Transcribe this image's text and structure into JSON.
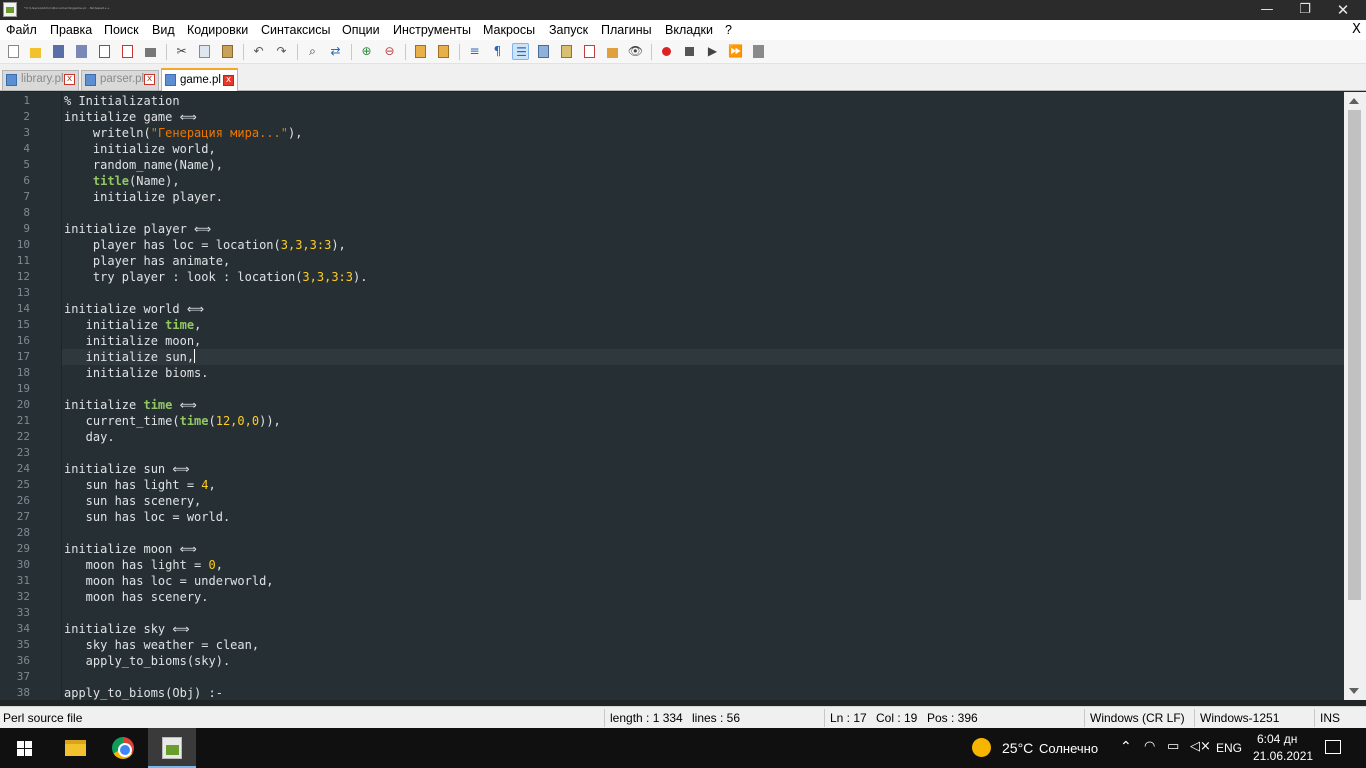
{
  "window": {
    "title": "*C:\\Users\\Admin\\Documents\\game.pl - Notepad++",
    "minimize": "—",
    "maximize": "❐",
    "close": "✕"
  },
  "menu": {
    "items": [
      "Файл",
      "Правка",
      "Поиск",
      "Вид",
      "Кодировки",
      "Синтаксисы",
      "Опции",
      "Инструменты",
      "Макросы",
      "Запуск",
      "Плагины",
      "Вкладки",
      "?"
    ],
    "close_doc": "X"
  },
  "tabs": [
    {
      "label": "library.pl",
      "active": false
    },
    {
      "label": "parser.pl",
      "active": false
    },
    {
      "label": "game.pl",
      "active": true
    }
  ],
  "tab_close_glyph": "x",
  "editor": {
    "line_numbers": [
      "1",
      "2",
      "3",
      "4",
      "5",
      "6",
      "7",
      "8",
      "9",
      "10",
      "11",
      "12",
      "13",
      "14",
      "15",
      "16",
      "17",
      "18",
      "19",
      "20",
      "21",
      "22",
      "23",
      "24",
      "25",
      "26",
      "27",
      "28",
      "29",
      "30",
      "31",
      "32",
      "33",
      "34",
      "35",
      "36",
      "37",
      "38"
    ],
    "current_line": 17
  },
  "code_text": {
    "l1": "% Initialization",
    "l2": "initialize game ⟺",
    "l3a": "    writeln(",
    "l3s": "\"Генерация мира...\"",
    "l3b": "),",
    "l4": "    initialize world,",
    "l5": "    random_name(Name),",
    "l6a": "    ",
    "l6k": "title",
    "l6b": "(Name),",
    "l7": "    initialize player.",
    "l9": "initialize player ⟺",
    "l10a": "    player has loc = location(",
    "l10n": "3,3,3:3",
    "l10b": "),",
    "l11": "    player has animate,",
    "l12a": "    try player : look : location(",
    "l12n": "3,3,3:3",
    "l12b": ").",
    "l14": "initialize world ⟺",
    "l15a": "   initialize ",
    "l15k": "time",
    "l15b": ",",
    "l16": "   initialize moon,",
    "l17": "   initialize sun,",
    "l18": "   initialize bioms.",
    "l20a": "initialize ",
    "l20k": "time",
    "l20b": " ⟺",
    "l21a": "   current_time(",
    "l21k": "time",
    "l21b": "(",
    "l21n": "12,0,0",
    "l21c": ")),",
    "l22": "   day.",
    "l24": "initialize sun ⟺",
    "l25a": "   sun has light = ",
    "l25n": "4",
    "l25b": ",",
    "l26": "   sun has scenery,",
    "l27": "   sun has loc = world.",
    "l29": "initialize moon ⟺",
    "l30a": "   moon has light = ",
    "l30n": "0",
    "l30b": ",",
    "l31": "   moon has loc = underworld,",
    "l32": "   moon has scenery.",
    "l34": "initialize sky ⟺",
    "l35": "   sky has weather = clean,",
    "l36": "   apply_to_bioms(sky).",
    "l38": "apply_to_bioms(Obj) :-"
  },
  "colors": {
    "editor_bg": "#263034",
    "string": "#ec7600",
    "keyword": "#93c763",
    "number": "#ffcd22",
    "tab_accent": "#f5a623"
  },
  "status": {
    "file_type": "Perl source file",
    "length": "length : 1 334",
    "lines": "lines : 56",
    "ln": "Ln : 17",
    "col": "Col : 19",
    "pos": "Pos : 396",
    "eol": "Windows (CR LF)",
    "encoding": "Windows-1251",
    "mode": "INS"
  },
  "taskbar": {
    "apps": [
      "file-explorer",
      "chrome",
      "notepad-plus-plus"
    ],
    "weather_temp": "25°C",
    "weather_text": "Солнечно",
    "lang": "ENG",
    "time": "6:04 дн",
    "date": "21.06.2021"
  }
}
